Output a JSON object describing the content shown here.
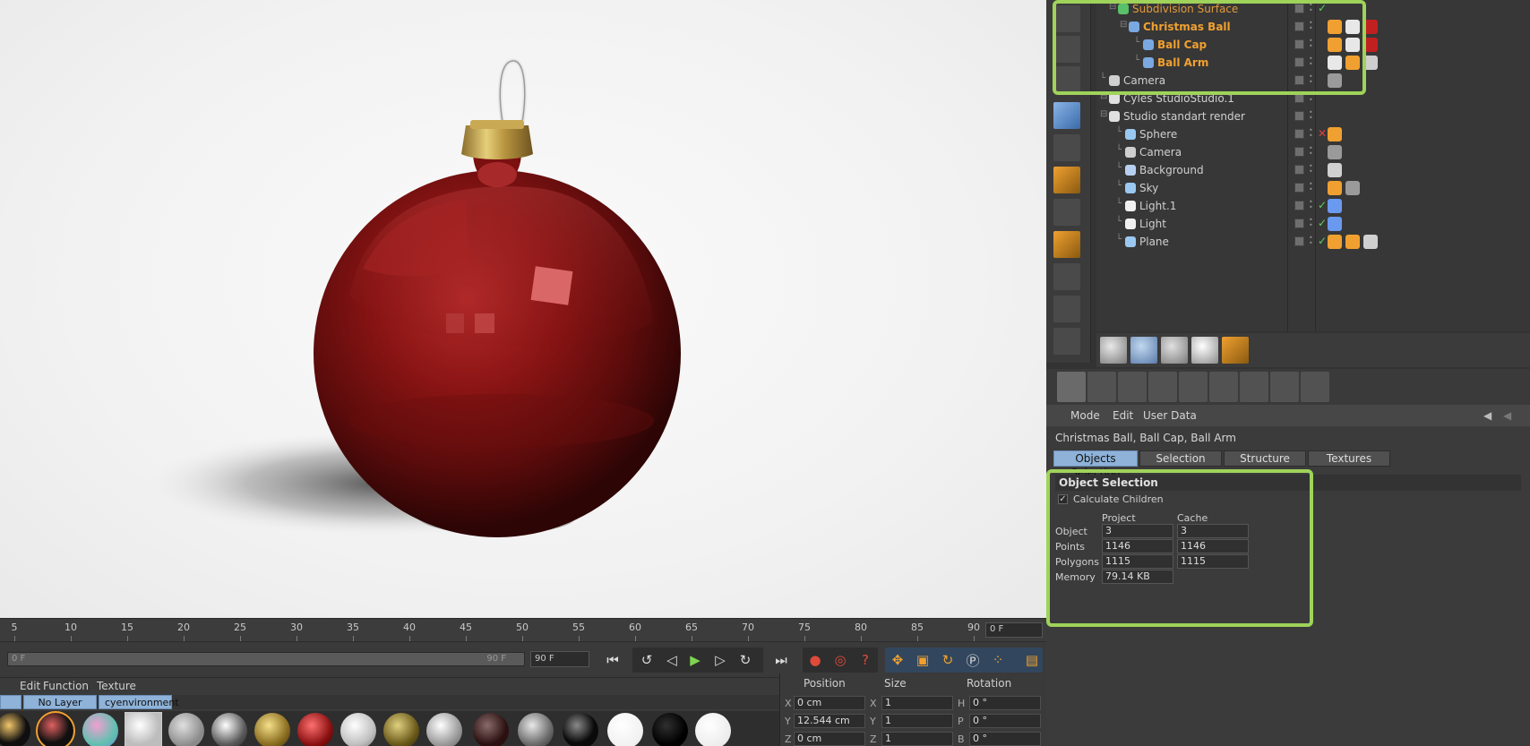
{
  "timeline": {
    "ticks": [
      "5",
      "10",
      "15",
      "20",
      "25",
      "30",
      "35",
      "40",
      "45",
      "50",
      "55",
      "60",
      "65",
      "70",
      "75",
      "80",
      "85",
      "90"
    ],
    "current_frame": "0 F",
    "range_start": "0 F",
    "range_end": "90 F",
    "end_frame": "90 F"
  },
  "material_manager": {
    "menu": {
      "edit": "Edit",
      "function": "Function",
      "texture": "Texture"
    },
    "tabs": {
      "no_layer": "No Layer",
      "env": "cyenvironment"
    }
  },
  "coordinates": {
    "headers": {
      "position": "Position",
      "size": "Size",
      "rotation": "Rotation"
    },
    "rows": [
      {
        "axis": "X",
        "pos": "0 cm",
        "size_axis": "X",
        "size": "1",
        "rot_axis": "H",
        "rot": "0 °"
      },
      {
        "axis": "Y",
        "pos": "12.544 cm",
        "size_axis": "Y",
        "size": "1",
        "rot_axis": "P",
        "rot": "0 °"
      },
      {
        "axis": "Z",
        "pos": "0 cm",
        "size_axis": "Z",
        "size": "1",
        "rot_axis": "B",
        "rot": "0 °"
      }
    ]
  },
  "object_manager": {
    "objects": [
      {
        "name": "Subdivision Surface",
        "style": "orange"
      },
      {
        "name": "Christmas Ball",
        "style": "sel"
      },
      {
        "name": "Ball Cap",
        "style": "sel"
      },
      {
        "name": "Ball Arm",
        "style": "sel"
      },
      {
        "name": "Camera",
        "style": "normal"
      },
      {
        "name": "Cyles StudioStudio.1",
        "style": "normal"
      },
      {
        "name": "Studio standart render",
        "style": "normal"
      },
      {
        "name": "Sphere",
        "style": "normal"
      },
      {
        "name": "Camera",
        "style": "normal"
      },
      {
        "name": "Background",
        "style": "normal"
      },
      {
        "name": "Sky",
        "style": "normal"
      },
      {
        "name": "Light.1",
        "style": "normal"
      },
      {
        "name": "Light",
        "style": "normal"
      },
      {
        "name": "Plane",
        "style": "normal"
      }
    ]
  },
  "attribute_manager": {
    "menu": {
      "mode": "Mode",
      "edit": "Edit",
      "user_data": "User Data"
    },
    "title": "Christmas Ball, Ball Cap, Ball Arm",
    "tabs": [
      "Objects Selection",
      "Selection",
      "Structure",
      "Textures"
    ],
    "section": "Object Selection",
    "calculate_children": "Calculate Children",
    "col_project": "Project",
    "col_cache": "Cache",
    "rows": [
      {
        "label": "Object",
        "project": "3",
        "cache": "3"
      },
      {
        "label": "Points",
        "project": "1146",
        "cache": "1146"
      },
      {
        "label": "Polygons",
        "project": "1115",
        "cache": "1115"
      },
      {
        "label": "Memory",
        "project": "79.14 KB",
        "cache": ""
      }
    ]
  },
  "colors": {
    "highlight": "#9fd35a",
    "selection_text": "#f0a030",
    "active_tab": "#8eb2d8"
  }
}
